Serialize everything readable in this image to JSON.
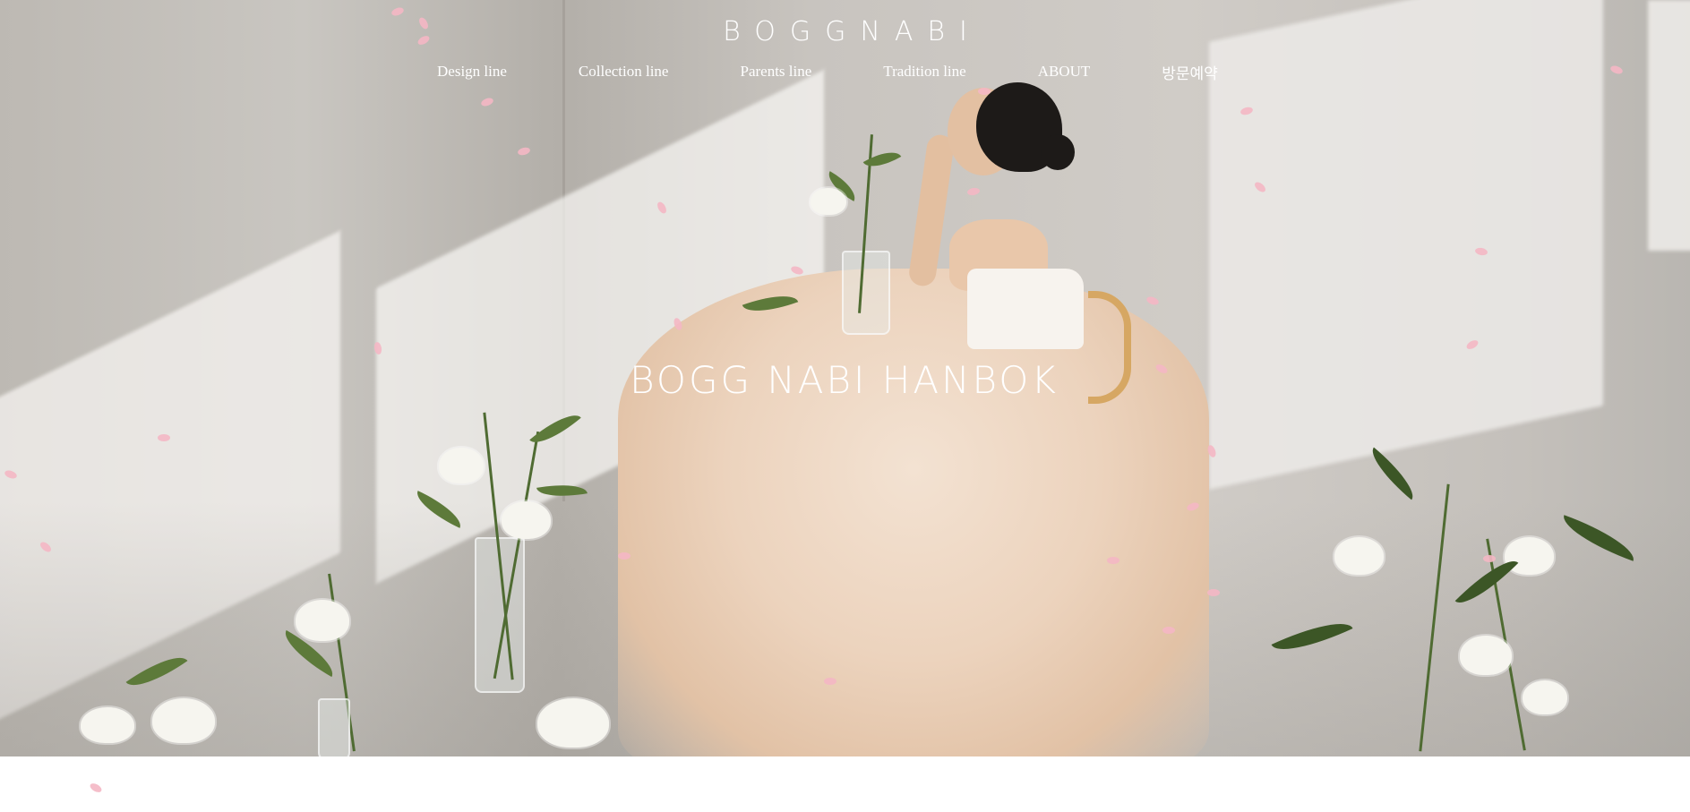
{
  "header": {
    "logo_text": "BOGGNABI",
    "nav": [
      {
        "label": "Design line"
      },
      {
        "label": "Collection line"
      },
      {
        "label": "Parents line"
      },
      {
        "label": "Tradition line"
      },
      {
        "label": "ABOUT"
      },
      {
        "label": "방문예약"
      }
    ]
  },
  "hero": {
    "title": "BOGG NABI HANBOK"
  },
  "colors": {
    "nav_text": "#ffffff",
    "petal": "#f4b7c4",
    "dress": "#ecd3bd"
  }
}
